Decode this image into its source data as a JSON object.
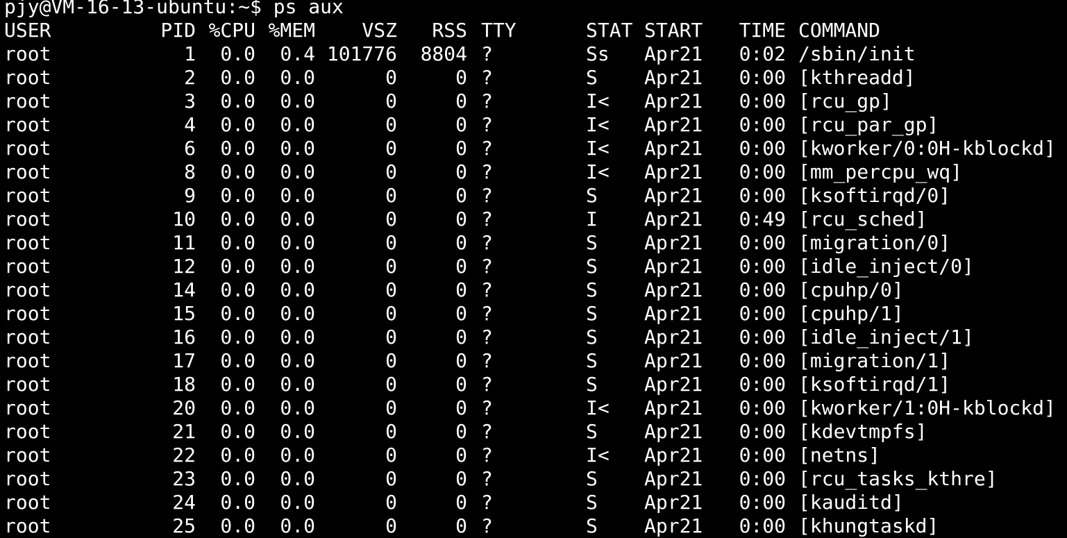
{
  "terminal": {
    "prompt": "pjy@VM-16-13-ubuntu:~$ ps aux",
    "background_color": "#000000",
    "text_color": "#ffffff"
  },
  "table": {
    "headers": {
      "user": "USER",
      "pid": "PID",
      "cpu": "%CPU",
      "mem": "%MEM",
      "vsz": "VSZ",
      "rss": "RSS",
      "tty": "TTY",
      "stat": "STAT",
      "start": "START",
      "time": "TIME",
      "command": "COMMAND"
    },
    "rows": [
      {
        "user": "root",
        "pid": "1",
        "cpu": "0.0",
        "mem": "0.4",
        "vsz": "101776",
        "rss": "8804",
        "tty": "?",
        "stat": "Ss",
        "start": "Apr21",
        "time": "0:02",
        "command": "/sbin/init"
      },
      {
        "user": "root",
        "pid": "2",
        "cpu": "0.0",
        "mem": "0.0",
        "vsz": "0",
        "rss": "0",
        "tty": "?",
        "stat": "S",
        "start": "Apr21",
        "time": "0:00",
        "command": "[kthreadd]"
      },
      {
        "user": "root",
        "pid": "3",
        "cpu": "0.0",
        "mem": "0.0",
        "vsz": "0",
        "rss": "0",
        "tty": "?",
        "stat": "I<",
        "start": "Apr21",
        "time": "0:00",
        "command": "[rcu_gp]"
      },
      {
        "user": "root",
        "pid": "4",
        "cpu": "0.0",
        "mem": "0.0",
        "vsz": "0",
        "rss": "0",
        "tty": "?",
        "stat": "I<",
        "start": "Apr21",
        "time": "0:00",
        "command": "[rcu_par_gp]"
      },
      {
        "user": "root",
        "pid": "6",
        "cpu": "0.0",
        "mem": "0.0",
        "vsz": "0",
        "rss": "0",
        "tty": "?",
        "stat": "I<",
        "start": "Apr21",
        "time": "0:00",
        "command": "[kworker/0:0H-kblockd]"
      },
      {
        "user": "root",
        "pid": "8",
        "cpu": "0.0",
        "mem": "0.0",
        "vsz": "0",
        "rss": "0",
        "tty": "?",
        "stat": "I<",
        "start": "Apr21",
        "time": "0:00",
        "command": "[mm_percpu_wq]"
      },
      {
        "user": "root",
        "pid": "9",
        "cpu": "0.0",
        "mem": "0.0",
        "vsz": "0",
        "rss": "0",
        "tty": "?",
        "stat": "S",
        "start": "Apr21",
        "time": "0:00",
        "command": "[ksoftirqd/0]"
      },
      {
        "user": "root",
        "pid": "10",
        "cpu": "0.0",
        "mem": "0.0",
        "vsz": "0",
        "rss": "0",
        "tty": "?",
        "stat": "I",
        "start": "Apr21",
        "time": "0:49",
        "command": "[rcu_sched]"
      },
      {
        "user": "root",
        "pid": "11",
        "cpu": "0.0",
        "mem": "0.0",
        "vsz": "0",
        "rss": "0",
        "tty": "?",
        "stat": "S",
        "start": "Apr21",
        "time": "0:00",
        "command": "[migration/0]"
      },
      {
        "user": "root",
        "pid": "12",
        "cpu": "0.0",
        "mem": "0.0",
        "vsz": "0",
        "rss": "0",
        "tty": "?",
        "stat": "S",
        "start": "Apr21",
        "time": "0:00",
        "command": "[idle_inject/0]"
      },
      {
        "user": "root",
        "pid": "14",
        "cpu": "0.0",
        "mem": "0.0",
        "vsz": "0",
        "rss": "0",
        "tty": "?",
        "stat": "S",
        "start": "Apr21",
        "time": "0:00",
        "command": "[cpuhp/0]"
      },
      {
        "user": "root",
        "pid": "15",
        "cpu": "0.0",
        "mem": "0.0",
        "vsz": "0",
        "rss": "0",
        "tty": "?",
        "stat": "S",
        "start": "Apr21",
        "time": "0:00",
        "command": "[cpuhp/1]"
      },
      {
        "user": "root",
        "pid": "16",
        "cpu": "0.0",
        "mem": "0.0",
        "vsz": "0",
        "rss": "0",
        "tty": "?",
        "stat": "S",
        "start": "Apr21",
        "time": "0:00",
        "command": "[idle_inject/1]"
      },
      {
        "user": "root",
        "pid": "17",
        "cpu": "0.0",
        "mem": "0.0",
        "vsz": "0",
        "rss": "0",
        "tty": "?",
        "stat": "S",
        "start": "Apr21",
        "time": "0:00",
        "command": "[migration/1]"
      },
      {
        "user": "root",
        "pid": "18",
        "cpu": "0.0",
        "mem": "0.0",
        "vsz": "0",
        "rss": "0",
        "tty": "?",
        "stat": "S",
        "start": "Apr21",
        "time": "0:00",
        "command": "[ksoftirqd/1]"
      },
      {
        "user": "root",
        "pid": "20",
        "cpu": "0.0",
        "mem": "0.0",
        "vsz": "0",
        "rss": "0",
        "tty": "?",
        "stat": "I<",
        "start": "Apr21",
        "time": "0:00",
        "command": "[kworker/1:0H-kblockd]"
      },
      {
        "user": "root",
        "pid": "21",
        "cpu": "0.0",
        "mem": "0.0",
        "vsz": "0",
        "rss": "0",
        "tty": "?",
        "stat": "S",
        "start": "Apr21",
        "time": "0:00",
        "command": "[kdevtmpfs]"
      },
      {
        "user": "root",
        "pid": "22",
        "cpu": "0.0",
        "mem": "0.0",
        "vsz": "0",
        "rss": "0",
        "tty": "?",
        "stat": "I<",
        "start": "Apr21",
        "time": "0:00",
        "command": "[netns]"
      },
      {
        "user": "root",
        "pid": "23",
        "cpu": "0.0",
        "mem": "0.0",
        "vsz": "0",
        "rss": "0",
        "tty": "?",
        "stat": "S",
        "start": "Apr21",
        "time": "0:00",
        "command": "[rcu_tasks_kthre]"
      },
      {
        "user": "root",
        "pid": "24",
        "cpu": "0.0",
        "mem": "0.0",
        "vsz": "0",
        "rss": "0",
        "tty": "?",
        "stat": "S",
        "start": "Apr21",
        "time": "0:00",
        "command": "[kauditd]"
      },
      {
        "user": "root",
        "pid": "25",
        "cpu": "0.0",
        "mem": "0.0",
        "vsz": "0",
        "rss": "0",
        "tty": "?",
        "stat": "S",
        "start": "Apr21",
        "time": "0:00",
        "command": "[khungtaskd]"
      }
    ]
  }
}
